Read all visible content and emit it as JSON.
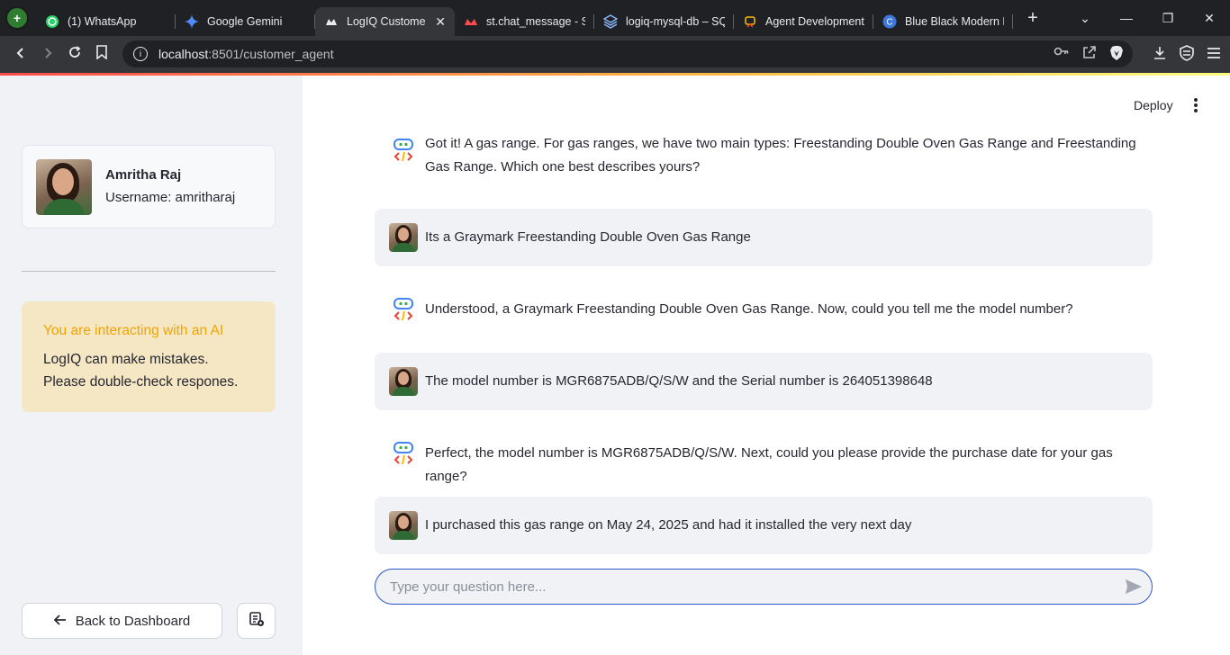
{
  "browser": {
    "tabs": [
      {
        "label": "(1) WhatsApp",
        "icon": "whatsapp-icon"
      },
      {
        "label": "Google Gemini",
        "icon": "gemini-icon"
      },
      {
        "label": "LogIQ Custome",
        "icon": "streamlit-icon",
        "active": true
      },
      {
        "label": "st.chat_message - St",
        "icon": "streamlit-icon"
      },
      {
        "label": "logiq-mysql-db – SQ",
        "icon": "layers-icon"
      },
      {
        "label": "Agent Development",
        "icon": "agent-icon"
      },
      {
        "label": "Blue Black Modern P",
        "icon": "canva-icon"
      }
    ],
    "url_host": "localhost",
    "url_path": ":8501/customer_agent"
  },
  "sidebar": {
    "profile": {
      "name": "Amritha Raj",
      "username": "Username: amritharaj"
    },
    "notice": {
      "title": "You are interacting with an AI",
      "body": "LogIQ can make mistakes. Please double-check respones."
    },
    "back_button": "Back to Dashboard"
  },
  "header": {
    "deploy": "Deploy"
  },
  "messages": [
    {
      "role": "assistant",
      "text": "Got it! A gas range. For gas ranges, we have two main types: Freestanding Double Oven Gas Range and Freestanding Gas Range. Which one best describes yours?"
    },
    {
      "role": "user",
      "text": "Its a Graymark Freestanding Double Oven Gas Range"
    },
    {
      "role": "assistant",
      "text": "Understood, a Graymark Freestanding Double Oven Gas Range. Now, could you tell me the model number?"
    },
    {
      "role": "user",
      "text": "The model number is MGR6875ADB/Q/S/W and the Serial number is 264051398648"
    },
    {
      "role": "assistant",
      "text": "Perfect, the model number is MGR6875ADB/Q/S/W. Next, could you please provide the purchase date for your gas range?"
    },
    {
      "role": "user",
      "text": "I purchased this gas range on May 24, 2025 and had it installed the very next day"
    }
  ],
  "chat_input": {
    "placeholder": "Type your question here...",
    "value": ""
  },
  "colors": {
    "accent": "#2b56c6",
    "sidebar_bg": "#f0f2f6",
    "notice_bg": "#f5e6c4",
    "notice_title": "#f0a500",
    "progress_start": "#ff4b4b"
  }
}
